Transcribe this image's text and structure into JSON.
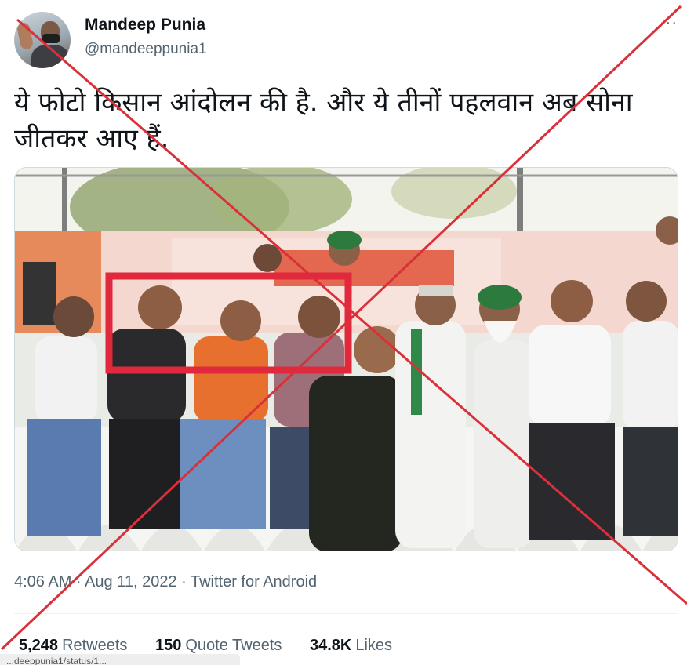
{
  "tweet": {
    "author_name": "Mandeep Punia",
    "author_handle": "@mandeeppunia1",
    "text": "ये फोटो किसान आंदोलन की है. और ये तीनों पहलवान अब सोना जीतकर आए हैं.",
    "timestamp": "4:06 AM · Aug 11, 2022 · Twitter for Android",
    "more_label": "···"
  },
  "stats": [
    {
      "count": "5,248",
      "label": "Retweets"
    },
    {
      "count": "150",
      "label": "Quote Tweets"
    },
    {
      "count": "34.8K",
      "label": "Likes"
    }
  ],
  "url_bar": "...deeppunia1/status/1...",
  "overlay": {
    "cross_color": "#d9303a",
    "highlight_color": "#e0293d"
  },
  "icons": {
    "more": "more-horizontal-icon",
    "avatar": "profile-photo"
  }
}
